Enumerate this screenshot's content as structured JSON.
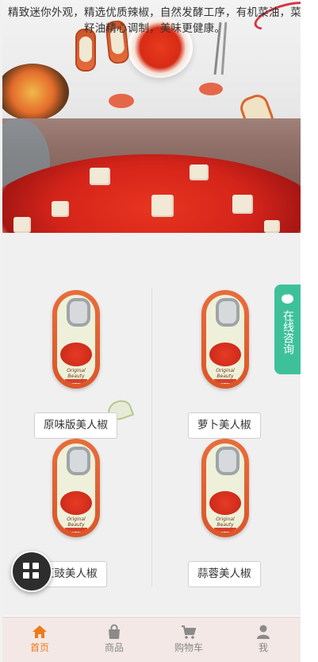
{
  "banner": {
    "text": "精致迷你外观，精选优质辣椒，自然发酵工序，有机菜油，菜籽油精心调制，美味更健康。"
  },
  "products": [
    {
      "name": "原味版美人椒",
      "can_label": "Original Beauty pepper"
    },
    {
      "name": "萝卜美人椒",
      "can_label": "Original Beauty pepper"
    },
    {
      "name": "豆豉美人椒",
      "can_label": "Original Beauty pepper"
    },
    {
      "name": "蒜蓉美人椒",
      "can_label": "Original Beauty pepper"
    }
  ],
  "consult": {
    "label": "在线咨询",
    "icon": "chat-bubble-icon"
  },
  "fab": {
    "icon": "grid-menu-icon"
  },
  "tabbar": {
    "items": [
      {
        "label": "首页",
        "icon": "home-icon",
        "active": true
      },
      {
        "label": "商品",
        "icon": "shopping-bag-icon",
        "active": false
      },
      {
        "label": "购物车",
        "icon": "cart-icon",
        "active": false
      },
      {
        "label": "我",
        "icon": "user-icon",
        "active": false
      }
    ]
  },
  "colors": {
    "accent": "#f07a1a",
    "consult": "#3ec19b",
    "tab_bg": "#f3e8e5"
  }
}
